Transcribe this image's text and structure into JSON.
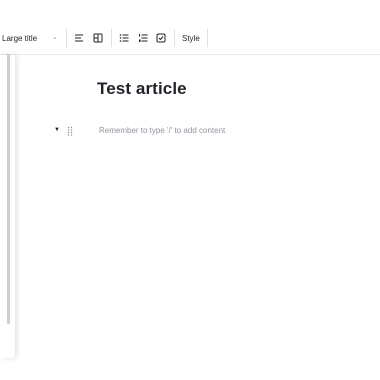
{
  "toolbar": {
    "text_style_label": "Large title",
    "style_label": "Style"
  },
  "document": {
    "title": "Test article",
    "placeholder": "Remember to type '/' to add content"
  },
  "icons": {
    "align": "align-left-icon",
    "layout": "layout-columns-icon",
    "bullet": "bulleted-list-icon",
    "numbered": "numbered-list-icon",
    "checkbox": "checkbox-icon",
    "drag": "drag-handle-icon",
    "caret": "caret-down-icon"
  }
}
